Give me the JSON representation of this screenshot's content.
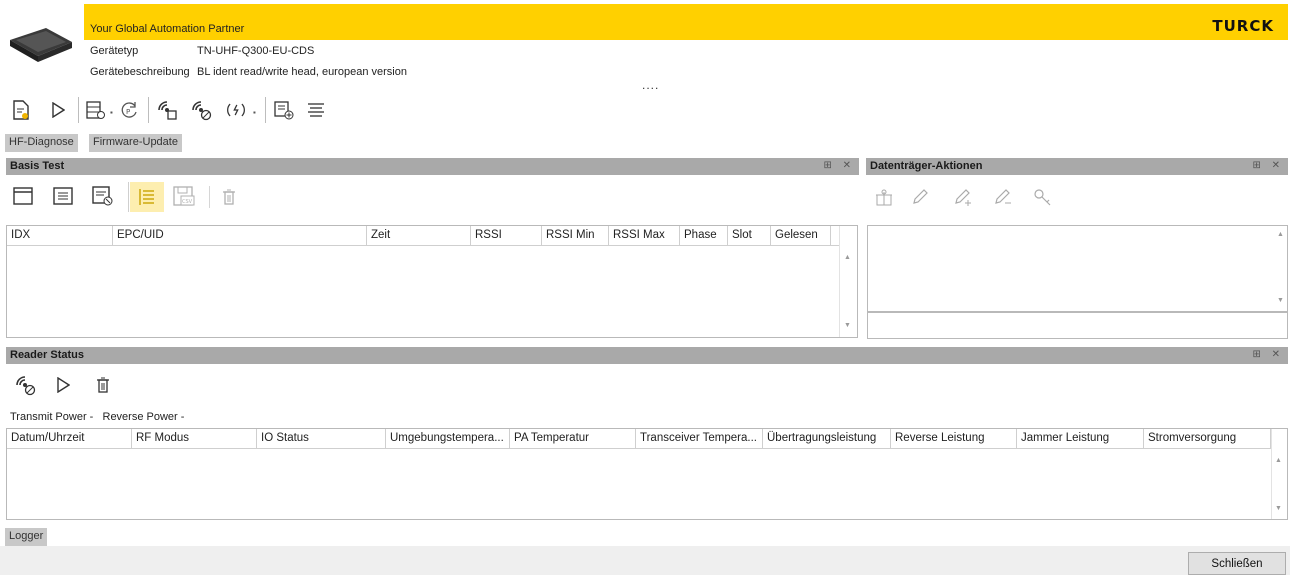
{
  "header": {
    "slogan": "Your Global Automation Partner",
    "brand": "TURCK",
    "device_type_label": "Gerätetyp",
    "device_type_value": "TN-UHF-Q300-EU-CDS",
    "device_desc_label": "Gerätebeschreibung",
    "device_desc_value": "BL ident read/write head, european version",
    "dots": "...."
  },
  "toolbar": {
    "icons": [
      "document-edit-icon",
      "play-icon",
      "list-settings-icon",
      "sync-icon",
      "rfid-chip-icon",
      "rfid-stop-icon",
      "signal-icon",
      "list-add-icon",
      "align-lines-icon"
    ]
  },
  "tabs": [
    "HF-Diagnose",
    "Firmware-Update"
  ],
  "basis_test": {
    "title": "Basis Test",
    "controls": "⊞ ✕",
    "columns": [
      "IDX",
      "EPC/UID",
      "Zeit",
      "RSSI",
      "RSSI Min",
      "RSSI Max",
      "Phase",
      "Slot",
      "Gelesen"
    ]
  },
  "datentraeger": {
    "title": "Datenträger-Aktionen",
    "controls": "⊞ ✕"
  },
  "reader_status": {
    "title": "Reader Status",
    "controls": "⊞ ✕",
    "status_text": "Transmit Power -   Reverse Power -",
    "columns": [
      "Datum/Uhrzeit",
      "RF Modus",
      "IO Status",
      "Umgebungstempera...",
      "PA Temperatur",
      "Transceiver Tempera...",
      "Übertragungsleistung",
      "Reverse Leistung",
      "Jammer Leistung",
      "Stromversorgung"
    ]
  },
  "logger_tab": "Logger",
  "close_label": "Schließen",
  "colors": {
    "banner": "#ffd000",
    "panel_header": "#a9a9a9",
    "tab": "#c8c8c8",
    "highlight": "#fdeeb0"
  }
}
